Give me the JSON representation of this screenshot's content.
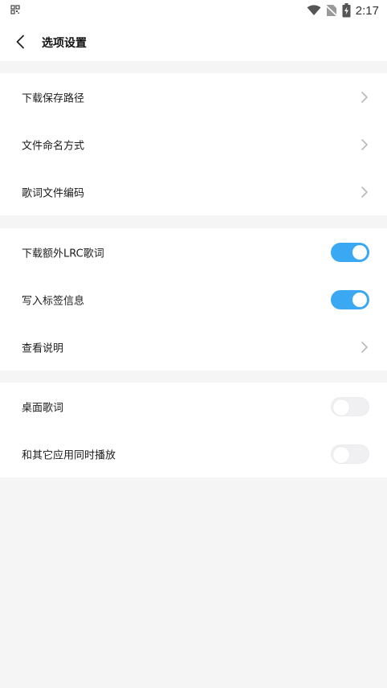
{
  "status_bar": {
    "time": "2:17",
    "icons": [
      "qr-grid-icon",
      "wifi-icon",
      "no-sim-icon",
      "battery-charging-icon"
    ]
  },
  "header": {
    "title": "选项设置",
    "back_icon": "back-chevron-icon"
  },
  "groups": [
    {
      "items": [
        {
          "label": "下载保存路径",
          "control": "chevron"
        },
        {
          "label": "文件命名方式",
          "control": "chevron"
        },
        {
          "label": "歌词文件编码",
          "control": "chevron"
        }
      ]
    },
    {
      "items": [
        {
          "label": "下载额外LRC歌词",
          "control": "toggle",
          "on": true
        },
        {
          "label": "写入标签信息",
          "control": "toggle",
          "on": true
        },
        {
          "label": "查看说明",
          "control": "chevron"
        }
      ]
    },
    {
      "items": [
        {
          "label": "桌面歌词",
          "control": "toggle",
          "on": false
        },
        {
          "label": "和其它应用同时播放",
          "control": "toggle",
          "on": false
        }
      ]
    }
  ],
  "colors": {
    "accent": "#3aa8f2",
    "background": "#f5f5f6",
    "surface": "#ffffff",
    "chevron": "#b8b8b8"
  }
}
